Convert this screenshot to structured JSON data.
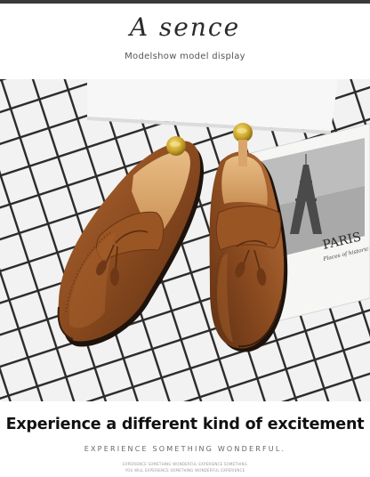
{
  "brand": {
    "logo_text": "A sence"
  },
  "subtitle": "Modelshow model display",
  "photo": {
    "postcard_text": "PARIS",
    "postcard_script": "Places of historic wo..."
  },
  "headline": "Experience a different kind of excitement",
  "tagline": "EXPERIENCE SOMETHING WONDERFUL.",
  "fine_print": [
    "EXPERIENCE SOMETHING WONDERFUL EXPERIENCE SOMETHING",
    "YOU WILL EXPERIENCE SOMETHING WONDERFUL EXPERIENCE"
  ],
  "colors": {
    "leather": "#8a4a1f",
    "leather_light": "#b06a34",
    "sole": "#2a1a10",
    "insole": "#d9a56a",
    "brass": "#c9a227",
    "grid_line": "#2a2a2a",
    "grid_bg": "#f2f2f2"
  }
}
